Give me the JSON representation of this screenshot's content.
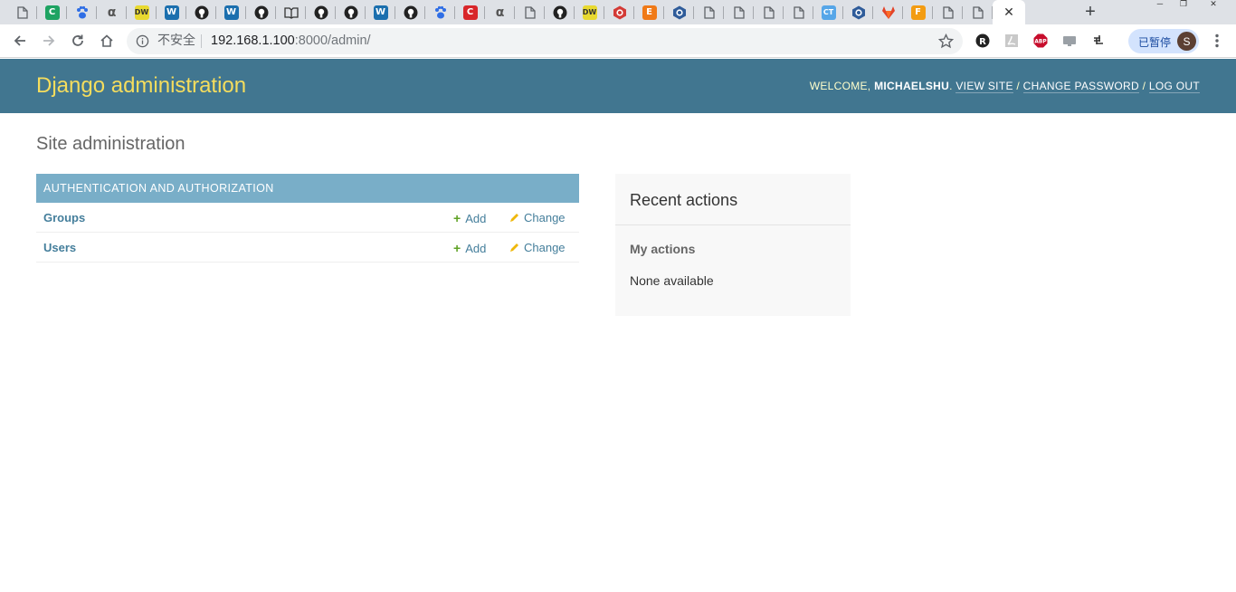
{
  "browser": {
    "tabs": [
      {
        "icon": "page-icon",
        "color": "#5f6368"
      },
      {
        "icon": "green-c-icon",
        "color": "#1ea362"
      },
      {
        "icon": "baidu-paw-icon",
        "color": "#2f6ee5"
      },
      {
        "icon": "alpha-icon",
        "color": "#555555"
      },
      {
        "icon": "dw-icon",
        "color": "#e8d930"
      },
      {
        "icon": "w-icon",
        "color": "#1b6fae"
      },
      {
        "icon": "github-icon",
        "color": "#222222"
      },
      {
        "icon": "w-icon",
        "color": "#1b6fae"
      },
      {
        "icon": "github-icon",
        "color": "#222222"
      },
      {
        "icon": "book-icon",
        "color": "#333333"
      },
      {
        "icon": "github-icon",
        "color": "#222222"
      },
      {
        "icon": "github-icon",
        "color": "#222222"
      },
      {
        "icon": "w-icon",
        "color": "#1b6fae"
      },
      {
        "icon": "github-icon",
        "color": "#222222"
      },
      {
        "icon": "baidu-paw-icon",
        "color": "#2f6ee5"
      },
      {
        "icon": "red-c-icon",
        "color": "#d8262a"
      },
      {
        "icon": "alpha-icon",
        "color": "#555555"
      },
      {
        "icon": "page-icon",
        "color": "#5f6368"
      },
      {
        "icon": "github-icon",
        "color": "#222222"
      },
      {
        "icon": "dw-icon",
        "color": "#e8d930"
      },
      {
        "icon": "hexagon-red-icon",
        "color": "#d33a36"
      },
      {
        "icon": "e-icon",
        "color": "#f07a18"
      },
      {
        "icon": "hexagon-blue-icon",
        "color": "#2f5c9a"
      },
      {
        "icon": "page-icon",
        "color": "#5f6368"
      },
      {
        "icon": "page-icon",
        "color": "#5f6368"
      },
      {
        "icon": "page-icon",
        "color": "#5f6368"
      },
      {
        "icon": "page-icon",
        "color": "#5f6368"
      },
      {
        "icon": "ct-icon",
        "color": "#56a6e8"
      },
      {
        "icon": "hexagon-blue-icon",
        "color": "#2f5c9a"
      },
      {
        "icon": "gitlab-icon",
        "color": "#e24329"
      },
      {
        "icon": "f-icon",
        "color": "#f39c12"
      },
      {
        "icon": "page-icon",
        "color": "#5f6368"
      },
      {
        "icon": "page-icon",
        "color": "#5f6368"
      }
    ],
    "tab_glyphs": {
      "dw-icon": "DW",
      "w-icon": "W",
      "e-icon": "E",
      "ct-icon": "CT",
      "red-c-icon": "C",
      "green-c-icon": "C",
      "f-icon": "F",
      "alpha-icon": "α"
    },
    "active_tab_close": "✕",
    "new_tab": "+",
    "security_label": "不安全",
    "url_host": "192.168.1.100",
    "url_rest": ":8000/admin/",
    "profile_status": "已暂停",
    "profile_initial": "S",
    "extensions": [
      "r-extension-icon",
      "pdf-extension-icon",
      "adblock-plus-icon",
      "cast-icon",
      "grid-extension-icon"
    ],
    "abp_label": "ABP"
  },
  "admin": {
    "brand": "Django administration",
    "welcome": "Welcome,",
    "username": "michaelshu",
    "view_site": "View site",
    "change_password": "Change password",
    "log_out": "Log out",
    "page_title": "Site administration",
    "app_caption": "Authentication and Authorization",
    "models": [
      {
        "name": "Groups",
        "add": "Add",
        "change": "Change"
      },
      {
        "name": "Users",
        "add": "Add",
        "change": "Change"
      }
    ],
    "recent_title": "Recent actions",
    "my_actions": "My actions",
    "none_available": "None available"
  },
  "colors": {
    "header_bg": "#417690",
    "brand": "#f5dd5d",
    "caption_bg": "#79aec8",
    "link": "#447e9b",
    "add_green": "#5fa225",
    "change_yellow": "#efb80b"
  }
}
